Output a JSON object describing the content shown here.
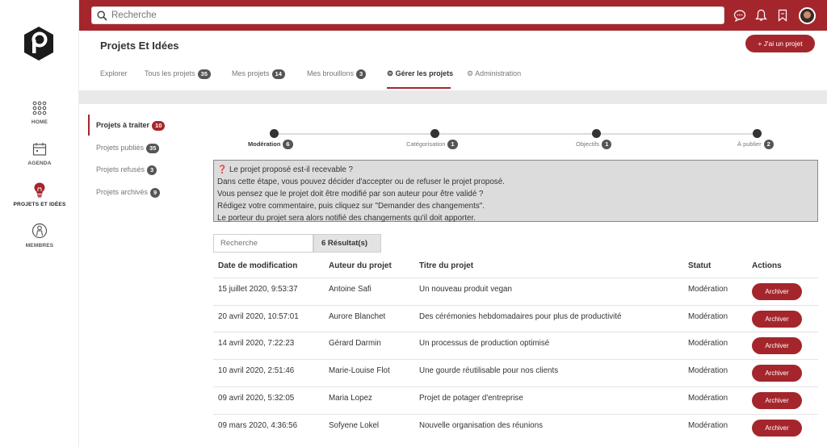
{
  "sidebar": {
    "items": [
      {
        "label": "HOME",
        "icon": "grid-icon"
      },
      {
        "label": "AGENDA",
        "icon": "calendar-icon"
      },
      {
        "label": "PROJETS ET IDÉES",
        "icon": "lightbulb-icon"
      },
      {
        "label": "MEMBRES",
        "icon": "person-icon"
      }
    ]
  },
  "topbar": {
    "search_placeholder": "Recherche",
    "accent": "#a4262c"
  },
  "header": {
    "title": "Projets Et Idées",
    "add_button": "+ J'ai un projet"
  },
  "tabs": [
    {
      "label": "Explorer",
      "count": ""
    },
    {
      "label": "Tous les projets",
      "count": "35"
    },
    {
      "label": "Mes projets",
      "count": "14"
    },
    {
      "label": "Mes brouillons",
      "count": "3"
    },
    {
      "label": "Gérer les projets",
      "count": ""
    },
    {
      "label": "Administration",
      "count": ""
    }
  ],
  "subnav": [
    {
      "label": "Projets à traiter",
      "count": "10"
    },
    {
      "label": "Projets publiés",
      "count": "35"
    },
    {
      "label": "Projets refusés",
      "count": "3"
    },
    {
      "label": "Projets archivés",
      "count": "9"
    }
  ],
  "steps": [
    {
      "label": "Modération",
      "count": "6"
    },
    {
      "label": "Catégorisation",
      "count": "1"
    },
    {
      "label": "Objectifs",
      "count": "1"
    },
    {
      "label": "À publier",
      "count": "2"
    }
  ],
  "info": {
    "lines": [
      "Le projet proposé est-il recevable ?",
      "Dans cette étape, vous pouvez décider d'accepter ou de refuser le projet proposé.",
      "Vous pensez que le projet doit être modifié par son auteur pour être validé ?",
      "Rédigez votre commentaire, puis cliquez sur \"Demander des changements\".",
      "Le porteur du projet sera alors notifié des changements qu'il doit apporter."
    ]
  },
  "table": {
    "search_placeholder": "Recherche",
    "results": "6 Résultat(s)",
    "headers": [
      "Date de modification",
      "Auteur du projet",
      "Titre du projet",
      "Statut",
      "Actions"
    ],
    "action_label": "Archiver",
    "rows": [
      [
        "15 juillet 2020, 9:53:37",
        "Antoine Safi",
        "Un nouveau produit vegan",
        "Modération"
      ],
      [
        "20 avril 2020, 10:57:01",
        "Aurore Blanchet",
        "Des cérémonies hebdomadaires pour plus de productivité",
        "Modération"
      ],
      [
        "14 avril 2020, 7:22:23",
        "Gérard Darmin",
        "Un processus de production optimisé",
        "Modération"
      ],
      [
        "10 avril 2020, 2:51:46",
        "Marie-Louise Flot",
        "Une gourde réutilisable pour nos clients",
        "Modération"
      ],
      [
        "09 avril 2020, 5:32:05",
        "Maria Lopez",
        "Projet de potager d'entreprise",
        "Modération"
      ],
      [
        "09 mars 2020, 4:36:56",
        "Sofyene Lokel",
        "Nouvelle organisation des réunions",
        "Modération"
      ]
    ]
  }
}
